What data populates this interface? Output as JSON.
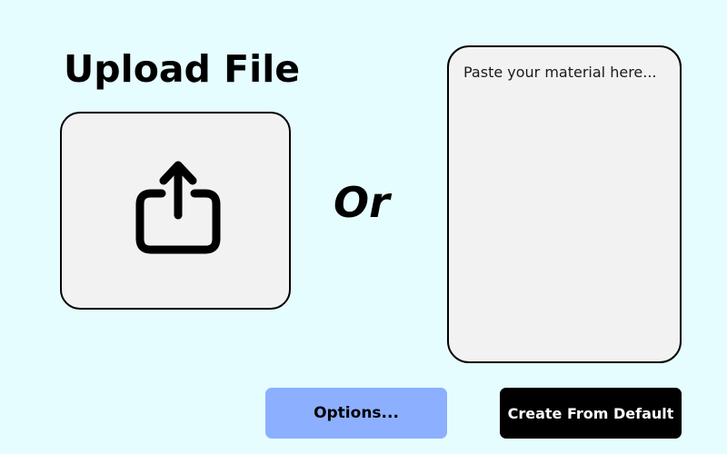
{
  "upload": {
    "title": "Upload File",
    "icon": "share-upload-icon"
  },
  "separator": {
    "text": "Or"
  },
  "paste": {
    "placeholder": "Paste your material here...",
    "value": ""
  },
  "buttons": {
    "options_label": "Options...",
    "create_default_label": "Create From Default"
  },
  "colors": {
    "background": "#e6fdff",
    "panel": "#f2f2f2",
    "options_button": "#8cb0ff",
    "default_button": "#000000"
  }
}
